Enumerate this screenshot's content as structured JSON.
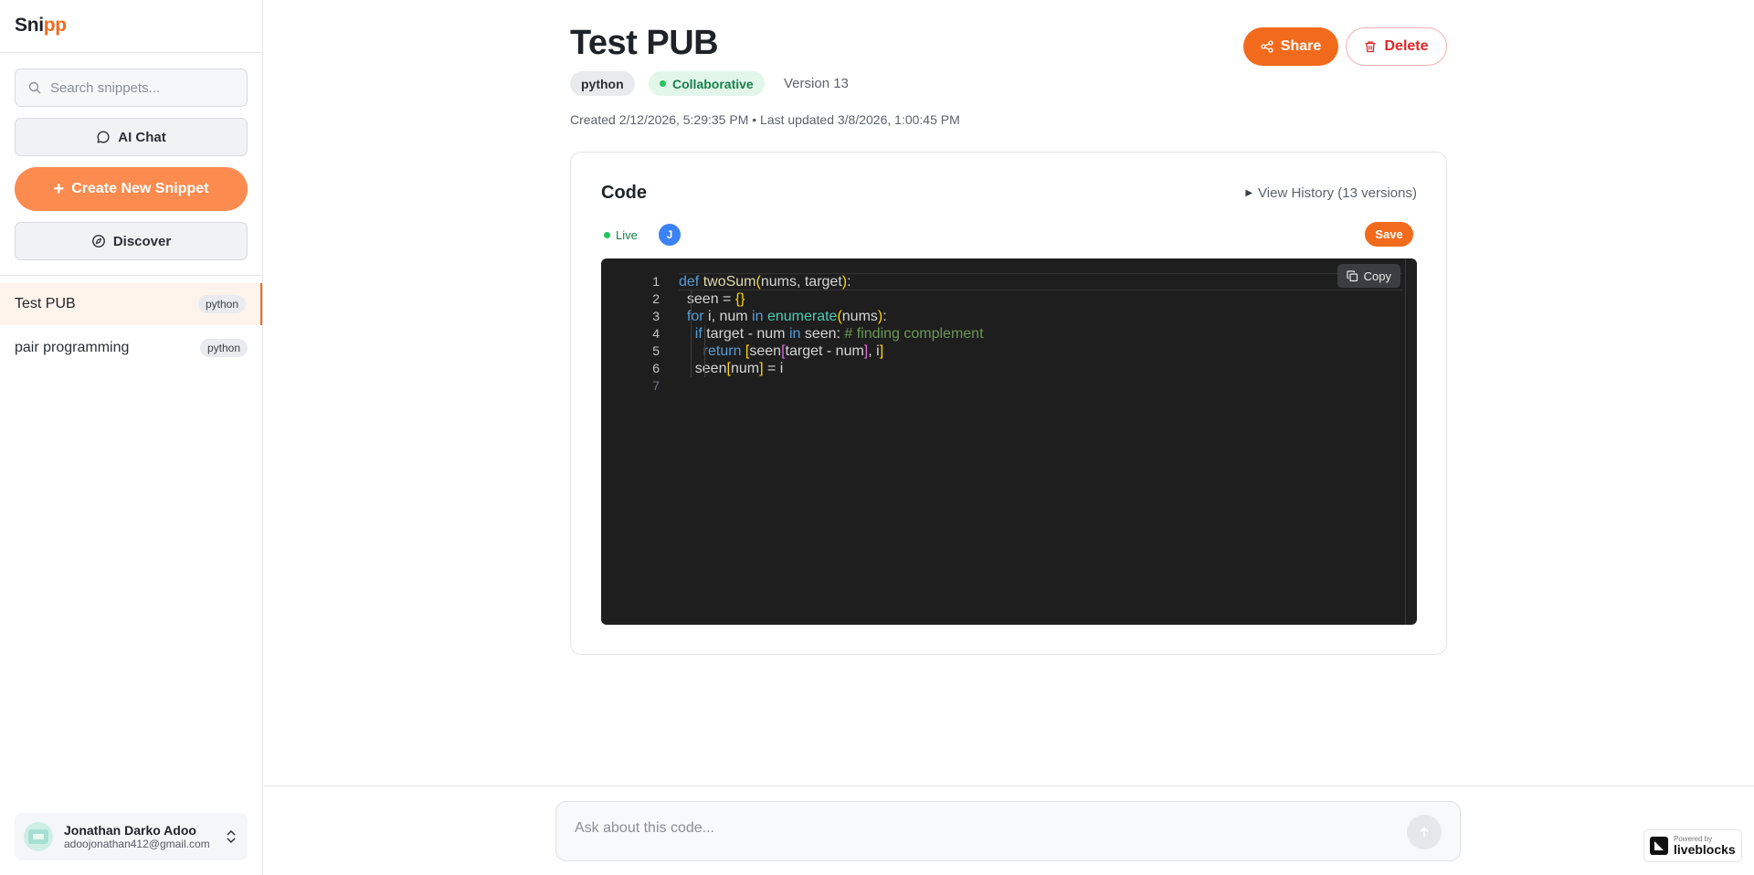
{
  "brand": {
    "part1": "Sni",
    "part2": "pp"
  },
  "sidebar": {
    "search_placeholder": "Search snippets...",
    "ai_chat_label": "AI Chat",
    "create_label": "Create New Snippet",
    "discover_label": "Discover",
    "snippets": [
      {
        "title": "Test PUB",
        "lang": "python",
        "active": true
      },
      {
        "title": "pair programming",
        "lang": "python",
        "active": false
      }
    ],
    "user": {
      "name": "Jonathan Darko Adoo",
      "email": "adoojonathan412@gmail.com"
    }
  },
  "snippet": {
    "title": "Test PUB",
    "language": "python",
    "mode": "Collaborative",
    "version": "Version 13",
    "meta": "Created 2/12/2026, 5:29:35 PM • Last updated 3/8/2026, 1:00:45 PM",
    "share_label": "Share",
    "delete_label": "Delete"
  },
  "code_panel": {
    "title": "Code",
    "history_label": "View History (13 versions)",
    "live_label": "Live",
    "collaborator_initial": "J",
    "save_label": "Save",
    "copy_label": "Copy",
    "line_numbers": [
      "1",
      "2",
      "3",
      "4",
      "5",
      "6",
      "7"
    ],
    "code": [
      "def twoSum(nums, target):",
      "  seen = {}",
      "  for i, num in enumerate(nums):",
      "    if target - num in seen: # finding complement",
      "      return [seen[target - num], i]",
      "    seen[num] = i",
      ""
    ]
  },
  "chat": {
    "placeholder": "Ask about this code..."
  },
  "powered_by": {
    "small": "Powered by",
    "brand": "liveblocks"
  },
  "colors": {
    "accent": "#f26a1b",
    "create_button": "#fb8b4f",
    "live_green": "#22c55e",
    "delete_red": "#dc2626",
    "editor_bg": "#1e1e1e"
  }
}
